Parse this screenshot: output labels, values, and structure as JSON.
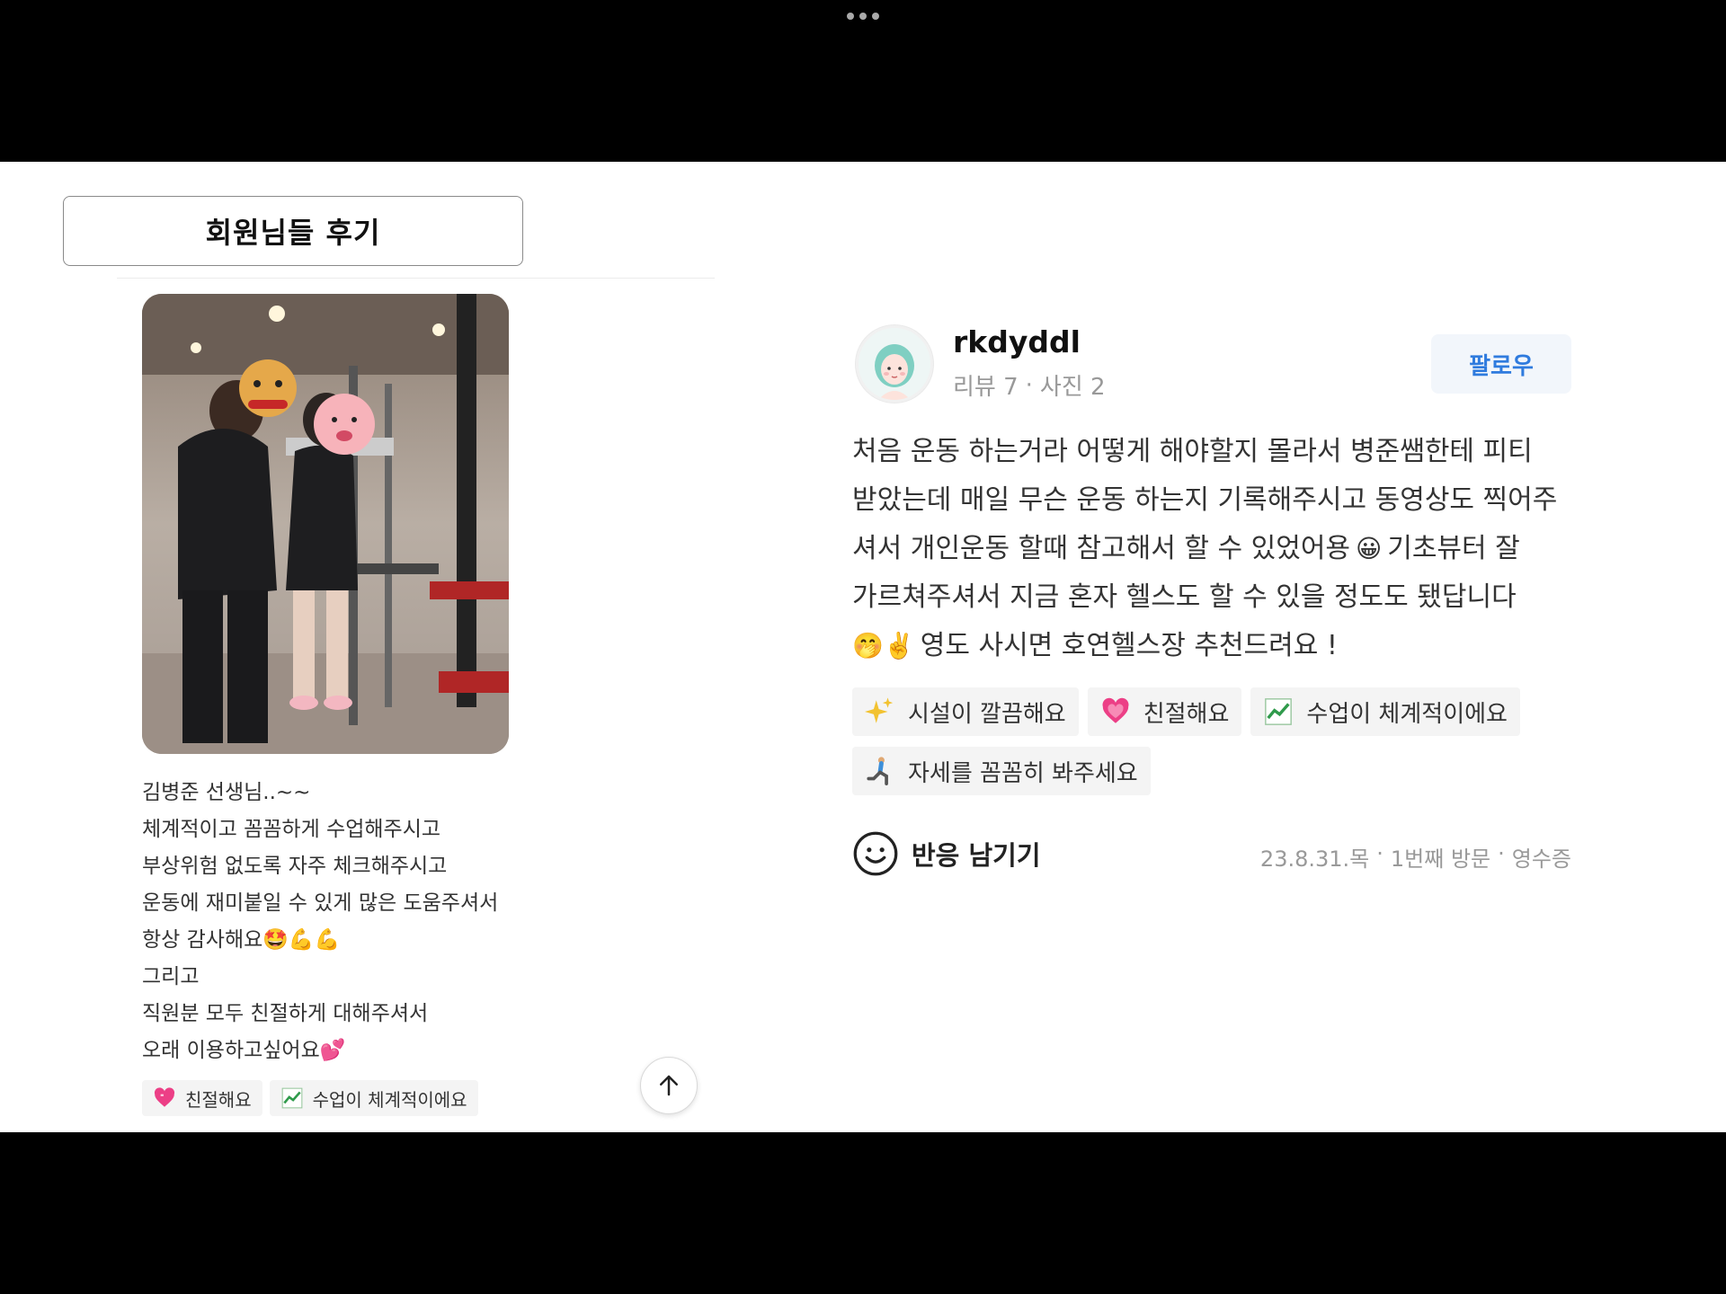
{
  "window": {
    "menu_icon": "more-dots-icon"
  },
  "section": {
    "title": "회원님들 후기"
  },
  "left_review": {
    "lines": [
      "김병준 선생님..~~",
      "체계적이고 꼼꼼하게 수업해주시고",
      "부상위험 없도록 자주 체크해주시고",
      "운동에 재미붙일 수 있게 많은 도움주셔서",
      "항상 감사해요🤩💪💪",
      "그리고",
      "직원분 모두 친절하게 대해주셔서",
      "오래 이용하고싶어요💕"
    ],
    "chips": [
      {
        "icon": "heart-icon",
        "label": "친절해요"
      },
      {
        "icon": "chart-up-icon",
        "label": "수업이 체계적이에요"
      }
    ],
    "scroll_top_icon": "arrow-up-icon"
  },
  "right_review": {
    "username": "rkdyddl",
    "review_count": "리뷰 7",
    "separator": "·",
    "photo_count": "사진 2",
    "follow_label": "팔로우",
    "lines": [
      "처음 운동 하는거라 어떻게 해야할지 몰라서 병준쌤한테 피티",
      "받았는데 매일 무슨 운동 하는지 기록해주시고 동영상도 찍어주",
      "셔서 개인운동 할때 참고해서 할 수 있었어용",
      "😀",
      "기초뷰터 잘",
      "가르쳐주셔서 지금 혼자 헬스도 할 수 있을 정도도 됐답니다",
      "🤭✌️",
      "영도 사시면 호연헬스장 추천드려요 !"
    ],
    "chips": [
      {
        "icon": "sparkles-icon",
        "label": "시설이 깔끔해요"
      },
      {
        "icon": "heart-icon",
        "label": "친절해요"
      },
      {
        "icon": "chart-up-icon",
        "label": "수업이 체계적이에요"
      },
      {
        "icon": "lunge-icon",
        "label": "자세를 꼼꼼히 봐주세요"
      }
    ],
    "reaction_label": "반응 남기기",
    "date": "23.8.31.목",
    "visit": "1번째 방문",
    "receipt": "영수증"
  }
}
